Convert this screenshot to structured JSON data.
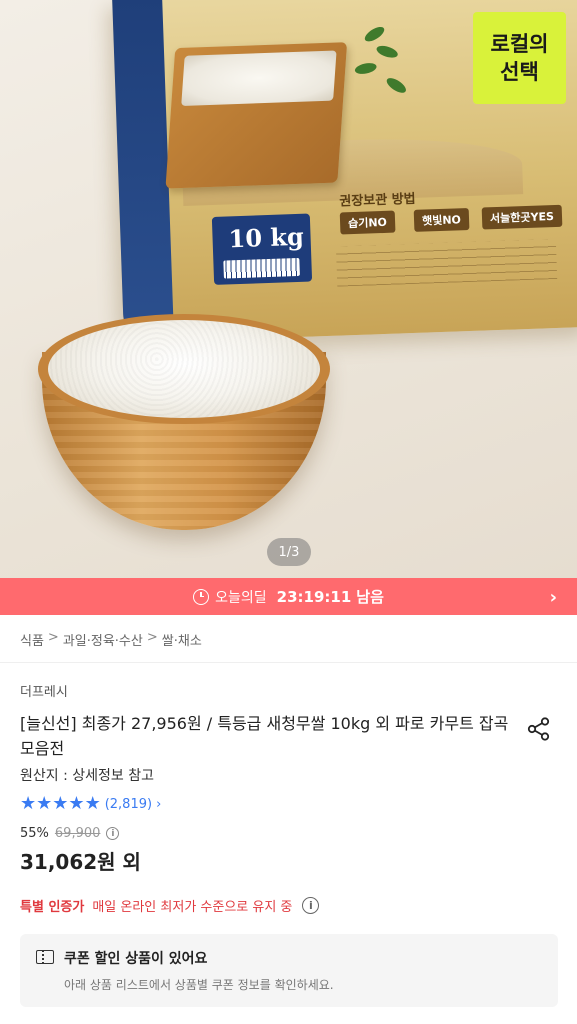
{
  "hero": {
    "counter": "1/3",
    "badge_line1": "로컬의",
    "badge_line2": "선택",
    "bag_weight": "10 kg",
    "storage_title": "권장보관 방법",
    "chips": [
      "습기NO",
      "햇빛NO",
      "서늘한곳YES"
    ]
  },
  "deal": {
    "label": "오늘의딜",
    "time": "23:19:11",
    "suffix": "남음",
    "arrow": "›"
  },
  "breadcrumb": {
    "items": [
      "식품",
      "과일·정육·수산",
      "쌀·채소"
    ],
    "separator": ">"
  },
  "product": {
    "seller": "더프레시",
    "title": "[늘신선] 최종가 27,956원 / 특등급 새청무쌀 10kg 외 파로 카무트 잡곡 모음전",
    "origin": "원산지 : 상세정보 참고",
    "rating_stars": 5,
    "reviews": "(2,819)",
    "reviews_arrow": "›",
    "discount": "55%",
    "original_price": "69,900",
    "final_price": "31,062원 외"
  },
  "certification": {
    "label": "특별 인증가",
    "text": "매일 온라인 최저가 수준으로 유지 중"
  },
  "coupon": {
    "title": "쿠폰 할인 상품이 있어요",
    "description": "아래 상품 리스트에서 상품별 쿠폰 정보를 확인하세요."
  },
  "colors": {
    "deal_bar": "#ff6a6e",
    "star": "#3a7bf2",
    "cert_red": "#e0393e",
    "badge": "#d9f23a"
  },
  "icons": {
    "clock": "clock-icon",
    "arrow": "chevron-right-icon",
    "share": "share-icon",
    "info": "info-icon",
    "coupon": "coupon-icon"
  }
}
